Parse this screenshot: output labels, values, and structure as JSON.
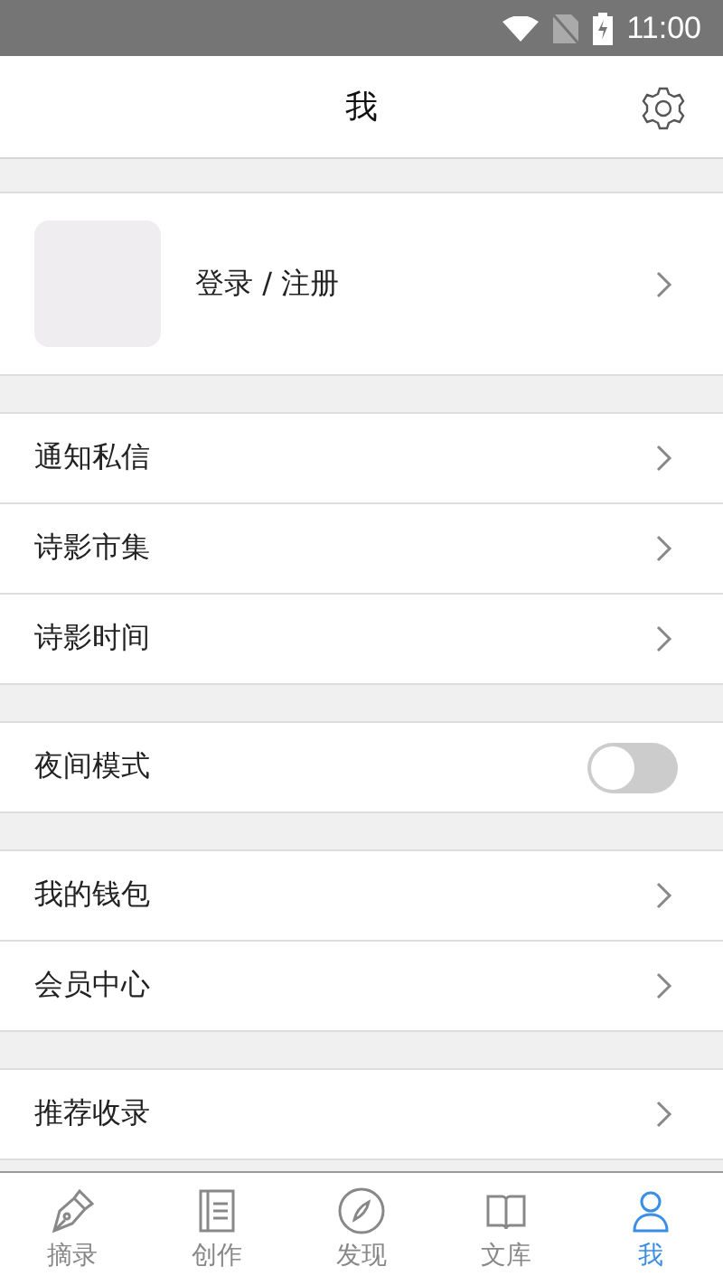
{
  "status_bar": {
    "time": "11:00"
  },
  "header": {
    "title": "我"
  },
  "profile": {
    "label": "登录 / 注册"
  },
  "groups": [
    {
      "items": [
        {
          "kind": "link",
          "label": "通知私信"
        },
        {
          "kind": "link",
          "label": "诗影市集"
        },
        {
          "kind": "link",
          "label": "诗影时间"
        }
      ]
    },
    {
      "items": [
        {
          "kind": "toggle",
          "label": "夜间模式",
          "on": false
        }
      ]
    },
    {
      "items": [
        {
          "kind": "link",
          "label": "我的钱包"
        },
        {
          "kind": "link",
          "label": "会员中心"
        }
      ]
    },
    {
      "items": [
        {
          "kind": "link",
          "label": "推荐收录"
        }
      ]
    }
  ],
  "tabs": [
    {
      "label": "摘录",
      "kind": "pen",
      "selected": false
    },
    {
      "label": "创作",
      "kind": "doc",
      "selected": false
    },
    {
      "label": "发现",
      "kind": "compass",
      "selected": false
    },
    {
      "label": "文库",
      "kind": "book",
      "selected": false
    },
    {
      "label": "我",
      "kind": "person",
      "selected": true
    }
  ]
}
